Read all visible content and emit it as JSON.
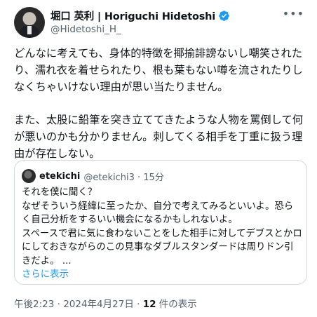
{
  "tweet": {
    "author_name": "堀口 英利 | Horiguchi Hidetoshi",
    "author_handle": "@Hidetoshi_H_",
    "paragraphs": [
      "どんなに考えても、身体的特徴を揶揄誹謗ないし嘲笑されたり、濡れ衣を着せられたり、根も葉もない噂を流されたりしなくちゃいけない理由が思い当たりません。",
      "また、太股に鉛筆を突き立ててきたような人物を罵倒して何が悪いのかも分かりません。刺してくる相手を丁重に扱う理由が存在しない。"
    ],
    "more_icon": "more-horizontal-icon",
    "verified_icon": "verified-badge-icon",
    "time": "午後2:23 · 2024年4月27日 · ",
    "views_count": "12",
    "views_label": " 件の表示"
  },
  "quote": {
    "name": "etekichi",
    "handle_time": "@etekichi3 · 15分",
    "lines": [
      "それを僕に聞く？",
      "なぜそういう経緯に至ったか、自分で考えてみるといいよ。恐らく自己分析をするいい機会になるかもしれないよ。",
      "スペースで君に気に食わないことをした相手に対してデブスとかロにしておきながらのこの見事なダブルスタンダードは周りドン引きだよ。 ..."
    ],
    "show_more": "さらに表示"
  },
  "colors": {
    "accent": "#1d9bf0",
    "secondary_text": "#536471",
    "border": "#cfd9de"
  }
}
